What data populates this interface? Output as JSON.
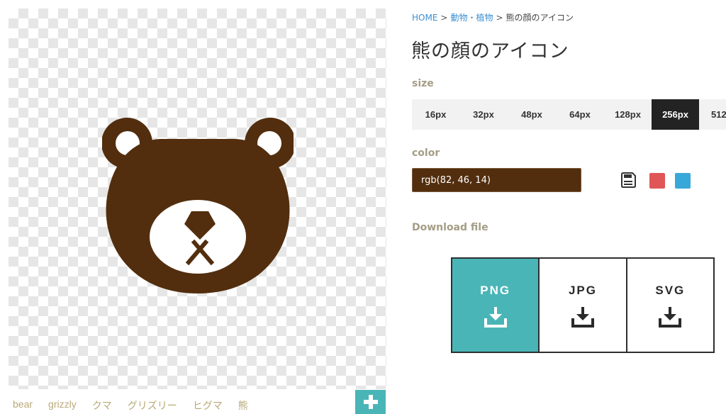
{
  "breadcrumb": {
    "home": "HOME",
    "sep": ">",
    "category": "動物・植物",
    "current": "熊の顔のアイコン"
  },
  "title": "熊の顔のアイコン",
  "size_section": {
    "label": "size",
    "options": [
      "16px",
      "32px",
      "48px",
      "64px",
      "128px",
      "256px",
      "512"
    ],
    "selected": "256px"
  },
  "color_section": {
    "label": "color",
    "value": "rgb(82, 46, 14)",
    "swatches": [
      {
        "name": "red",
        "color": "#e05555"
      },
      {
        "name": "blue",
        "color": "#38a8d8"
      }
    ]
  },
  "download": {
    "label": "Download file",
    "formats": [
      "PNG",
      "JPG",
      "SVG"
    ]
  },
  "tags": [
    "bear",
    "grizzly",
    "クマ",
    "グリズリー",
    "ヒグマ",
    "熊"
  ],
  "icon": {
    "name": "bear-face",
    "color": "#522e0e"
  },
  "colors": {
    "accent": "#4ab5b7",
    "active": "#232323",
    "label": "#a49d85",
    "link": "#3b8fd1"
  }
}
